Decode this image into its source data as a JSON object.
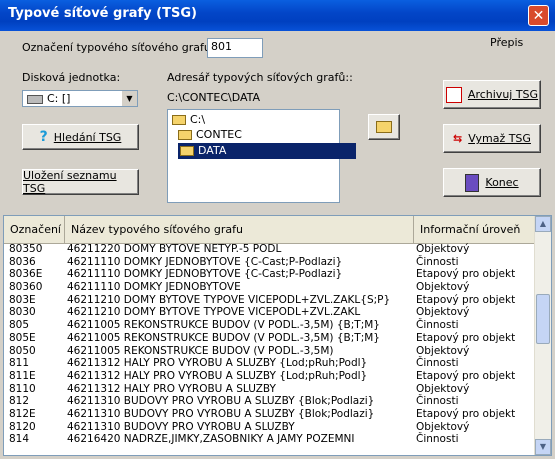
{
  "window": {
    "title": "Typové síťové grafy (TSG)",
    "close": "✕"
  },
  "form": {
    "designation_label": "Označení typového síťového grafu:",
    "designation_value": "801",
    "prepis_label": "Přepis",
    "drive_label": "Disková jednotka:",
    "drive_value": "C: []",
    "dir_label": "Adresář typových síťových grafů::",
    "dir_path": "C:\\CONTEC\\DATA",
    "dirs": [
      "C:\\",
      "CONTEC",
      "DATA"
    ]
  },
  "buttons": {
    "search": "Hledání TSG",
    "save_list": "Uložení seznamu TSG",
    "archive": "Archivuj TSG",
    "delete": "Vymaž TSG",
    "end": "Konec"
  },
  "table": {
    "headers": [
      "Označení",
      "Název typového síťového grafu",
      "Informační úroveň"
    ],
    "rows": [
      [
        "80350",
        "46211220 DOMY BYTOVE NETYP.-5 PODL",
        "Objektový"
      ],
      [
        "8036",
        "46211110 DOMKY JEDNOBYTOVE {C-Cast;P-Podlazi}",
        "Činnosti"
      ],
      [
        "8036E",
        "46211110 DOMKY JEDNOBYTOVE {C-Cast;P-Podlazi}",
        "Etapový pro objekt"
      ],
      [
        "80360",
        "46211110 DOMKY JEDNOBYTOVE",
        "Objektový"
      ],
      [
        "803E",
        "46211210 DOMY BYTOVE TYPOVE VICEPODL+ZVL.ZAKL{S;P}",
        "Etapový pro objekt"
      ],
      [
        "8030",
        "46211210 DOMY BYTOVE TYPOVE VICEPODL+ZVL.ZAKL",
        "Objektový"
      ],
      [
        "805",
        "46211005 REKONSTRUKCE BUDOV (V PODL.-3,5M) {B;T;M}",
        "Činnosti"
      ],
      [
        "805E",
        "46211005 REKONSTRUKCE BUDOV (V PODL.-3,5M) {B;T;M}",
        "Etapový pro objekt"
      ],
      [
        "8050",
        "46211005 REKONSTRUKCE BUDOV (V PODL.-3,5M)",
        "Objektový"
      ],
      [
        "811",
        "46211312 HALY PRO VYROBU A SLUZBY {Lod;pRuh;Podl}",
        "Činnosti"
      ],
      [
        "811E",
        "46211312 HALY PRO VYROBU A SLUZBY {Lod;pRuh;Podl}",
        "Etapový pro objekt"
      ],
      [
        "8110",
        "46211312 HALY PRO VYROBU A SLUZBY",
        "Objektový"
      ],
      [
        "812",
        "46211310 BUDOVY PRO VYROBU A SLUZBY {Blok;Podlazi}",
        "Činnosti"
      ],
      [
        "812E",
        "46211310 BUDOVY PRO VYROBU A SLUZBY {Blok;Podlazi}",
        "Etapový pro objekt"
      ],
      [
        "8120",
        "46211310 BUDOVY PRO VYROBU A SLUZBY",
        "Objektový"
      ],
      [
        "814",
        "46216420 NADRZE,JIMKY,ZASOBNIKY A JAMY POZEMNI",
        "Činnosti"
      ]
    ]
  }
}
